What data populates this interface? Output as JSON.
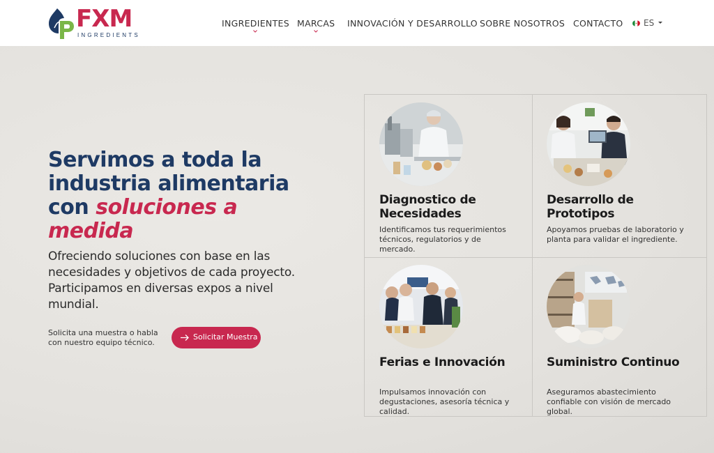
{
  "brand": {
    "name": "FXM",
    "tagline": "INGREDIENTS",
    "colors": {
      "primary": "#1e3a64",
      "accent": "#c8284f",
      "green": "#7ab648"
    }
  },
  "nav": {
    "items": [
      {
        "label": "INGREDIENTES",
        "has_dropdown": true
      },
      {
        "label": "MARCAS",
        "has_dropdown": true
      },
      {
        "label": "INNOVACIÓN Y DESARROLLO",
        "has_dropdown": false
      },
      {
        "label": "SOBRE NOSOTROS",
        "has_dropdown": false
      },
      {
        "label": "CONTACTO",
        "has_dropdown": false
      }
    ],
    "language": {
      "label": "ES",
      "flag": "mexico-flag-icon"
    }
  },
  "hero": {
    "headline_plain": "Servimos a toda la industria alimentaria con",
    "headline_accent": "soluciones a medida",
    "subtext": "Ofreciendo soluciones con base en las necesidades y objetivos de cada proyecto. Participamos en diversas expos a nivel mundial.",
    "cta_note": "Solicita una muestra o habla con nuestro equipo técnico.",
    "cta_button": "Solicitar Muestra",
    "cta_icon": "arrow-right-icon"
  },
  "cards": [
    {
      "title": "Diagnostico de Necesidades",
      "description": "Identificamos tus requerimientos técnicos, regulatorios y de mercado.",
      "image": "lab-scientist-photo"
    },
    {
      "title": "Desarrollo de Prototipos",
      "description": "Apoyamos pruebas de laboratorio y planta para validar el ingrediente.",
      "image": "business-meeting-photo"
    },
    {
      "title": "Ferias e Innovación",
      "description": "Impulsamos innovación con degustaciones, asesoría técnica y calidad.",
      "image": "trade-fair-photo"
    },
    {
      "title": "Suministro Continuo",
      "description": "Aseguramos abastecimiento confiable con visión de mercado global.",
      "image": "warehouse-photo"
    }
  ]
}
